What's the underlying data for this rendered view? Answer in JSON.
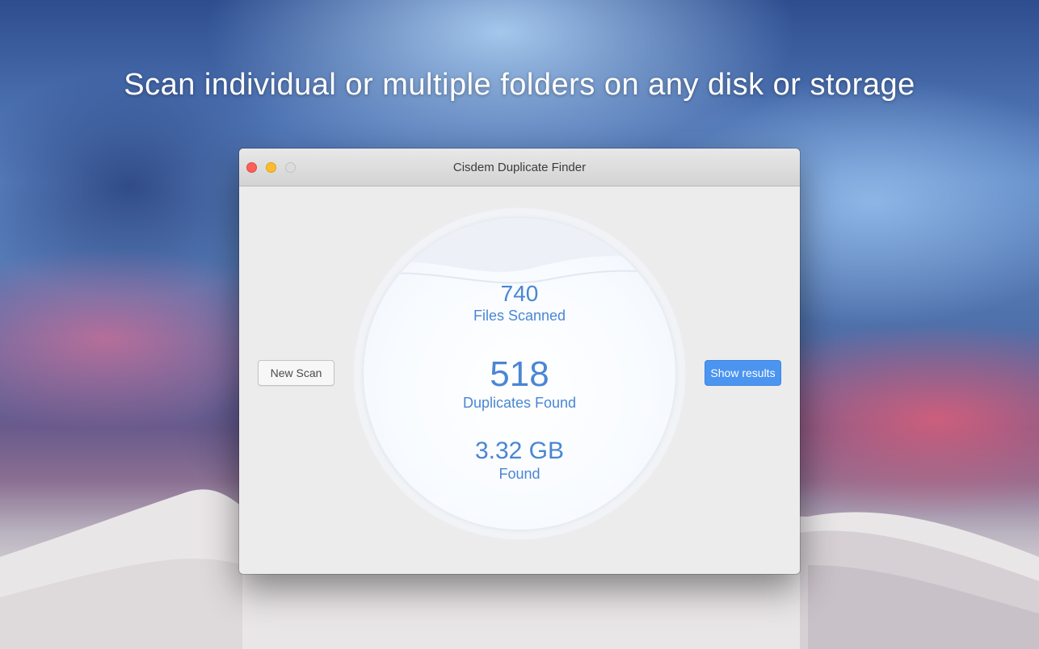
{
  "headline": "Scan individual or multiple folders on any disk or storage",
  "window": {
    "title": "Cisdem Duplicate Finder"
  },
  "stats": {
    "files_scanned": {
      "value": "740",
      "label": "Files Scanned"
    },
    "duplicates_found": {
      "value": "518",
      "label": "Duplicates Found"
    },
    "size_found": {
      "value": "3.32 GB",
      "label": "Found"
    }
  },
  "buttons": {
    "new_scan": "New Scan",
    "show_results": "Show results"
  },
  "colors": {
    "accent": "#4a86d3",
    "primary_button": "#4b94f0",
    "close": "#fc5f57",
    "minimize": "#fdbc2e"
  }
}
